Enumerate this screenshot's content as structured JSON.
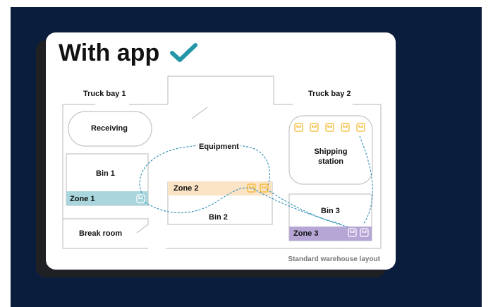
{
  "title": "With app",
  "check_icon": "check-mark-icon",
  "labels": {
    "truck_bay_1": "Truck bay 1",
    "truck_bay_2": "Truck bay 2",
    "receiving": "Receiving",
    "equipment": "Equipment",
    "shipping_station": "Shipping\nstation",
    "bin_1": "Bin 1",
    "bin_2": "Bin 2",
    "bin_3": "Bin 3",
    "zone_1": "Zone 1",
    "zone_2": "Zone 2",
    "zone_3": "Zone 3",
    "break_room": "Break room"
  },
  "caption": "Standard warehouse layout",
  "colors": {
    "background": "#0b1d3d",
    "card": "#ffffff",
    "check": "#2596a8",
    "zone_1": "#a8d6dc",
    "zone_2": "#fbe3c6",
    "zone_3": "#b6a6d6",
    "package_icon": "#f5b323",
    "route": "#2c8fb3",
    "wall": "#c4c4c4"
  },
  "icons": [
    "package-icon"
  ]
}
